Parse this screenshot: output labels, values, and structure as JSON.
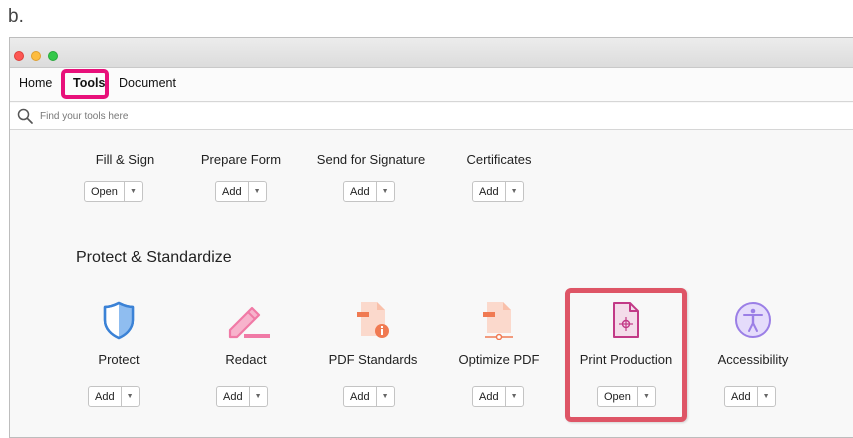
{
  "figure_label": "b.",
  "menu": {
    "home": "Home",
    "tools": "Tools",
    "document": "Document"
  },
  "search": {
    "placeholder": "Find your tools here"
  },
  "top_tools": [
    {
      "name": "Fill & Sign",
      "button": "Open"
    },
    {
      "name": "Prepare Form",
      "button": "Add"
    },
    {
      "name": "Send for Signature",
      "button": "Add"
    },
    {
      "name": "Certificates",
      "button": "Add"
    }
  ],
  "section": {
    "title": "Protect & Standardize",
    "tools": [
      {
        "name": "Protect",
        "button": "Add",
        "icon": "shield-icon"
      },
      {
        "name": "Redact",
        "button": "Add",
        "icon": "redact-marker-icon"
      },
      {
        "name": "PDF Standards",
        "button": "Add",
        "icon": "pdf-standards-icon"
      },
      {
        "name": "Optimize PDF",
        "button": "Add",
        "icon": "optimize-pdf-icon"
      },
      {
        "name": "Print Production",
        "button": "Open",
        "icon": "print-production-icon"
      },
      {
        "name": "Accessibility",
        "button": "Add",
        "icon": "accessibility-icon"
      }
    ]
  },
  "colors": {
    "tools_highlight": "#e8107a",
    "print_production_highlight": "#de5566",
    "protect_blue": "#3b82d6",
    "redact_pink": "#f07aa6",
    "pdf_orange": "#f07a52",
    "print_magenta": "#c23a87",
    "accessibility_purple": "#9b7fe6"
  },
  "dropdown_glyph": "▼"
}
